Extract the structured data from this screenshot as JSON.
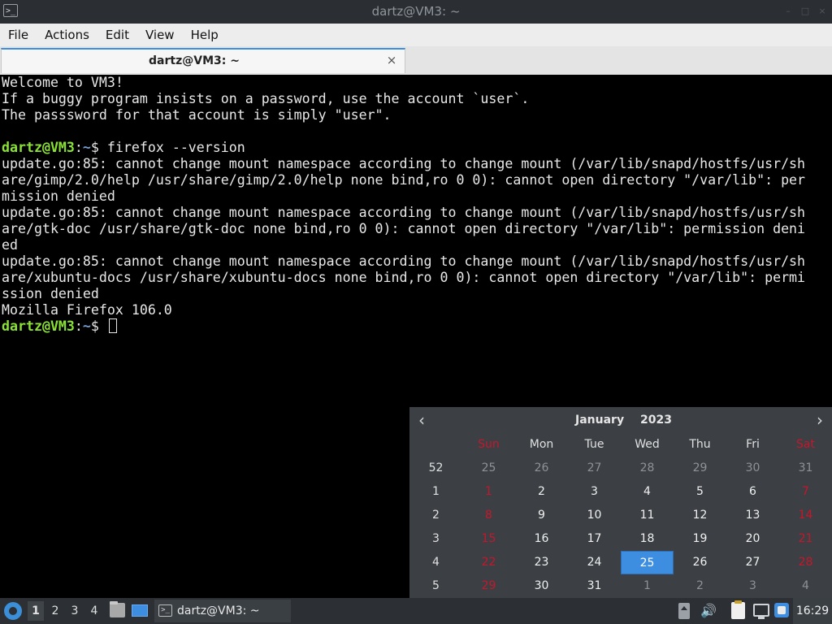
{
  "window": {
    "title": "dartz@VM3: ~",
    "app_icon_glyph": ">_",
    "controls": [
      "minimize-icon",
      "maximize-icon",
      "close-icon"
    ]
  },
  "menu": {
    "items": [
      "File",
      "Actions",
      "Edit",
      "View",
      "Help"
    ]
  },
  "tab": {
    "label": "dartz@VM3: ~",
    "close_glyph": "×"
  },
  "terminal": {
    "colors": {
      "user": "#8ae234",
      "path": "#729fcf",
      "text": "#e8e8e8"
    },
    "lines": [
      {
        "text": "Welcome to VM3!"
      },
      {
        "text": "If a buggy program insists on a password, use the account `user`."
      },
      {
        "text": "The passsword for that account is simply \"user\"."
      },
      {
        "text": ""
      },
      {
        "user": "dartz@VM3",
        "sep": ":",
        "path": "~",
        "sym": "$ ",
        "text": "firefox --version"
      },
      {
        "text": "update.go:85: cannot change mount namespace according to change mount (/var/lib/snapd/hostfs/usr/sh"
      },
      {
        "text": "are/gimp/2.0/help /usr/share/gimp/2.0/help none bind,ro 0 0): cannot open directory \"/var/lib\": per"
      },
      {
        "text": "mission denied"
      },
      {
        "text": "update.go:85: cannot change mount namespace according to change mount (/var/lib/snapd/hostfs/usr/sh"
      },
      {
        "text": "are/gtk-doc /usr/share/gtk-doc none bind,ro 0 0): cannot open directory \"/var/lib\": permission deni"
      },
      {
        "text": "ed"
      },
      {
        "text": "update.go:85: cannot change mount namespace according to change mount (/var/lib/snapd/hostfs/usr/sh"
      },
      {
        "text": "are/xubuntu-docs /usr/share/xubuntu-docs none bind,ro 0 0): cannot open directory \"/var/lib\": permi"
      },
      {
        "text": "ssion denied"
      },
      {
        "text": "Mozilla Firefox 106.0"
      },
      {
        "user": "dartz@VM3",
        "sep": ":",
        "path": "~",
        "sym": "$ ",
        "text": "",
        "cursor": true
      }
    ]
  },
  "calendar": {
    "month": "January",
    "year": "2023",
    "prev_glyph": "‹",
    "next_glyph": "›",
    "weekdays": [
      "Sun",
      "Mon",
      "Tue",
      "Wed",
      "Thu",
      "Fri",
      "Sat"
    ],
    "weeks": [
      {
        "num": "52",
        "days": [
          "25",
          "26",
          "27",
          "28",
          "29",
          "30",
          "31"
        ],
        "other": [
          true,
          true,
          true,
          true,
          true,
          true,
          true
        ]
      },
      {
        "num": "1",
        "days": [
          "1",
          "2",
          "3",
          "4",
          "5",
          "6",
          "7"
        ],
        "other": [
          false,
          false,
          false,
          false,
          false,
          false,
          false
        ]
      },
      {
        "num": "2",
        "days": [
          "8",
          "9",
          "10",
          "11",
          "12",
          "13",
          "14"
        ],
        "other": [
          false,
          false,
          false,
          false,
          false,
          false,
          false
        ]
      },
      {
        "num": "3",
        "days": [
          "15",
          "16",
          "17",
          "18",
          "19",
          "20",
          "21"
        ],
        "other": [
          false,
          false,
          false,
          false,
          false,
          false,
          false
        ]
      },
      {
        "num": "4",
        "days": [
          "22",
          "23",
          "24",
          "25",
          "26",
          "27",
          "28"
        ],
        "other": [
          false,
          false,
          false,
          false,
          false,
          false,
          false
        ]
      },
      {
        "num": "5",
        "days": [
          "29",
          "30",
          "31",
          "1",
          "2",
          "3",
          "4"
        ],
        "other": [
          false,
          false,
          false,
          true,
          true,
          true,
          true
        ]
      }
    ],
    "selected_day": "25",
    "colors": {
      "weekend": "#c7162b",
      "selected": "#3d8ee0"
    }
  },
  "taskbar": {
    "workspaces": [
      "1",
      "2",
      "3",
      "4"
    ],
    "active_workspace": "1",
    "task_label": "dartz@VM3: ~",
    "task_icon_glyph": ">_",
    "volume_glyph": "🔊",
    "clock": "16:29"
  }
}
